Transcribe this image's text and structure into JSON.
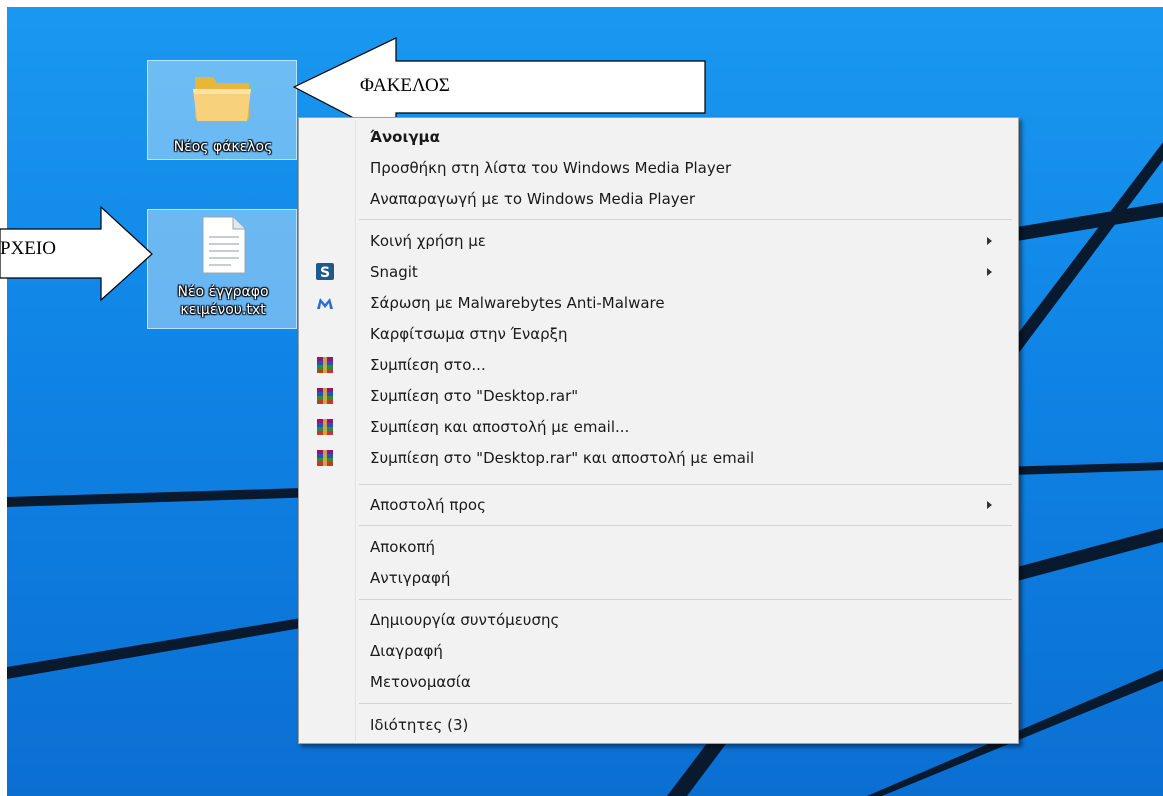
{
  "desktop": {
    "folder_icon": {
      "label": "Νέος φάκελος",
      "icon": "folder-icon"
    },
    "text_file_icon": {
      "label_line1": "Νέο έγγραφο",
      "label_line2": "κειμένου.txt",
      "icon": "text-document-icon"
    }
  },
  "annotations": {
    "folder_callout": "ΦΑΚΕΛΟΣ",
    "file_callout": "ΡΧΕΙΟ"
  },
  "context_menu": {
    "items": [
      {
        "label": "Άνοιγμα",
        "bold": true
      },
      {
        "label": "Προσθήκη στη λίστα του Windows Media Player"
      },
      {
        "label": "Αναπαραγωγή με το Windows Media Player"
      },
      {
        "label": "Κοινή χρήση με",
        "submenu": true
      },
      {
        "label": "Snagit",
        "submenu": true,
        "icon": "snagit-icon"
      },
      {
        "label": "Σάρωση με Malwarebytes Anti-Malware",
        "icon": "malwarebytes-icon"
      },
      {
        "label": "Καρφίτσωμα στην Έναρξη"
      },
      {
        "label": "Συμπίεση στο...",
        "icon": "winrar-icon"
      },
      {
        "label": "Συμπίεση στο \"Desktop.rar\"",
        "icon": "winrar-icon"
      },
      {
        "label": "Συμπίεση και αποστολή με email...",
        "icon": "winrar-icon"
      },
      {
        "label": "Συμπίεση στο \"Desktop.rar\" και αποστολή με email",
        "icon": "winrar-icon"
      },
      {
        "label": "Αποστολή προς",
        "submenu": true
      },
      {
        "label": "Αποκοπή"
      },
      {
        "label": "Αντιγραφή"
      },
      {
        "label": "Δημιουργία συντόμευσης"
      },
      {
        "label": "Διαγραφή"
      },
      {
        "label": "Μετονομασία"
      },
      {
        "label": "Ιδιότητες (3)"
      }
    ]
  },
  "colors": {
    "desktop_blue": "#1a98f0",
    "menu_background": "#f2f2f2",
    "snagit_blue": "#1e5a8c",
    "malwarebytes_blue": "#2a6dd4"
  }
}
